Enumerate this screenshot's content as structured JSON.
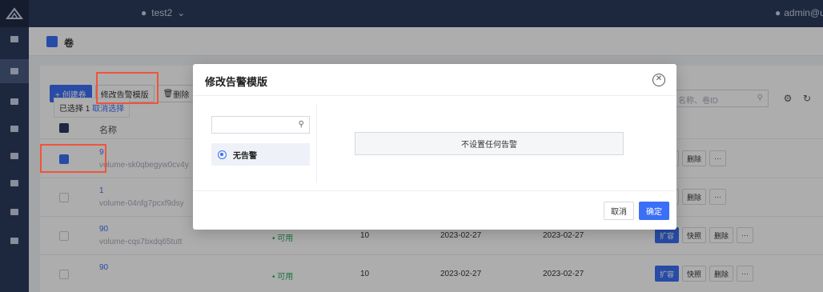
{
  "header": {
    "project": "test2",
    "user": "admin@u"
  },
  "page": {
    "title": "卷"
  },
  "toolbar": {
    "create_label": "+ 创建卷",
    "modify_alarm_label": "修改告警模版",
    "delete_label": "删除",
    "selected_prefix": "已选择 1",
    "cancel_select": "取消选择",
    "search_placeholder": "名称、卷ID"
  },
  "table": {
    "header_name": "名称",
    "rows": [
      {
        "name": "9",
        "sub": "volume-sk0qbegyw0cv4y",
        "status": "",
        "size": "",
        "date1": "",
        "date2": "",
        "checked": true
      },
      {
        "name": "1",
        "sub": "volume-04nfg7pcxf9dsy",
        "status": "",
        "size": "",
        "date1": "",
        "date2": "",
        "checked": false
      },
      {
        "name": "90",
        "sub": "volume-cqs7bxdq65tutt",
        "status": "• 可用",
        "size": "10",
        "date1": "2023-02-27",
        "date2": "2023-02-27",
        "checked": false
      },
      {
        "name": "90",
        "sub": "",
        "status": "• 可用",
        "size": "10",
        "date1": "2023-02-27",
        "date2": "2023-02-27",
        "checked": false
      }
    ],
    "op_expand": "扩容",
    "op_snapshot": "快照",
    "op_delete": "删除",
    "op_more": "···"
  },
  "modal": {
    "title": "修改告警模版",
    "option_none": "无告警",
    "none_display": "不设置任何告警",
    "cancel_label": "取消",
    "ok_label": "确定"
  },
  "colors": {
    "accent": "#3b6ff5",
    "highlight": "#f0543a"
  }
}
